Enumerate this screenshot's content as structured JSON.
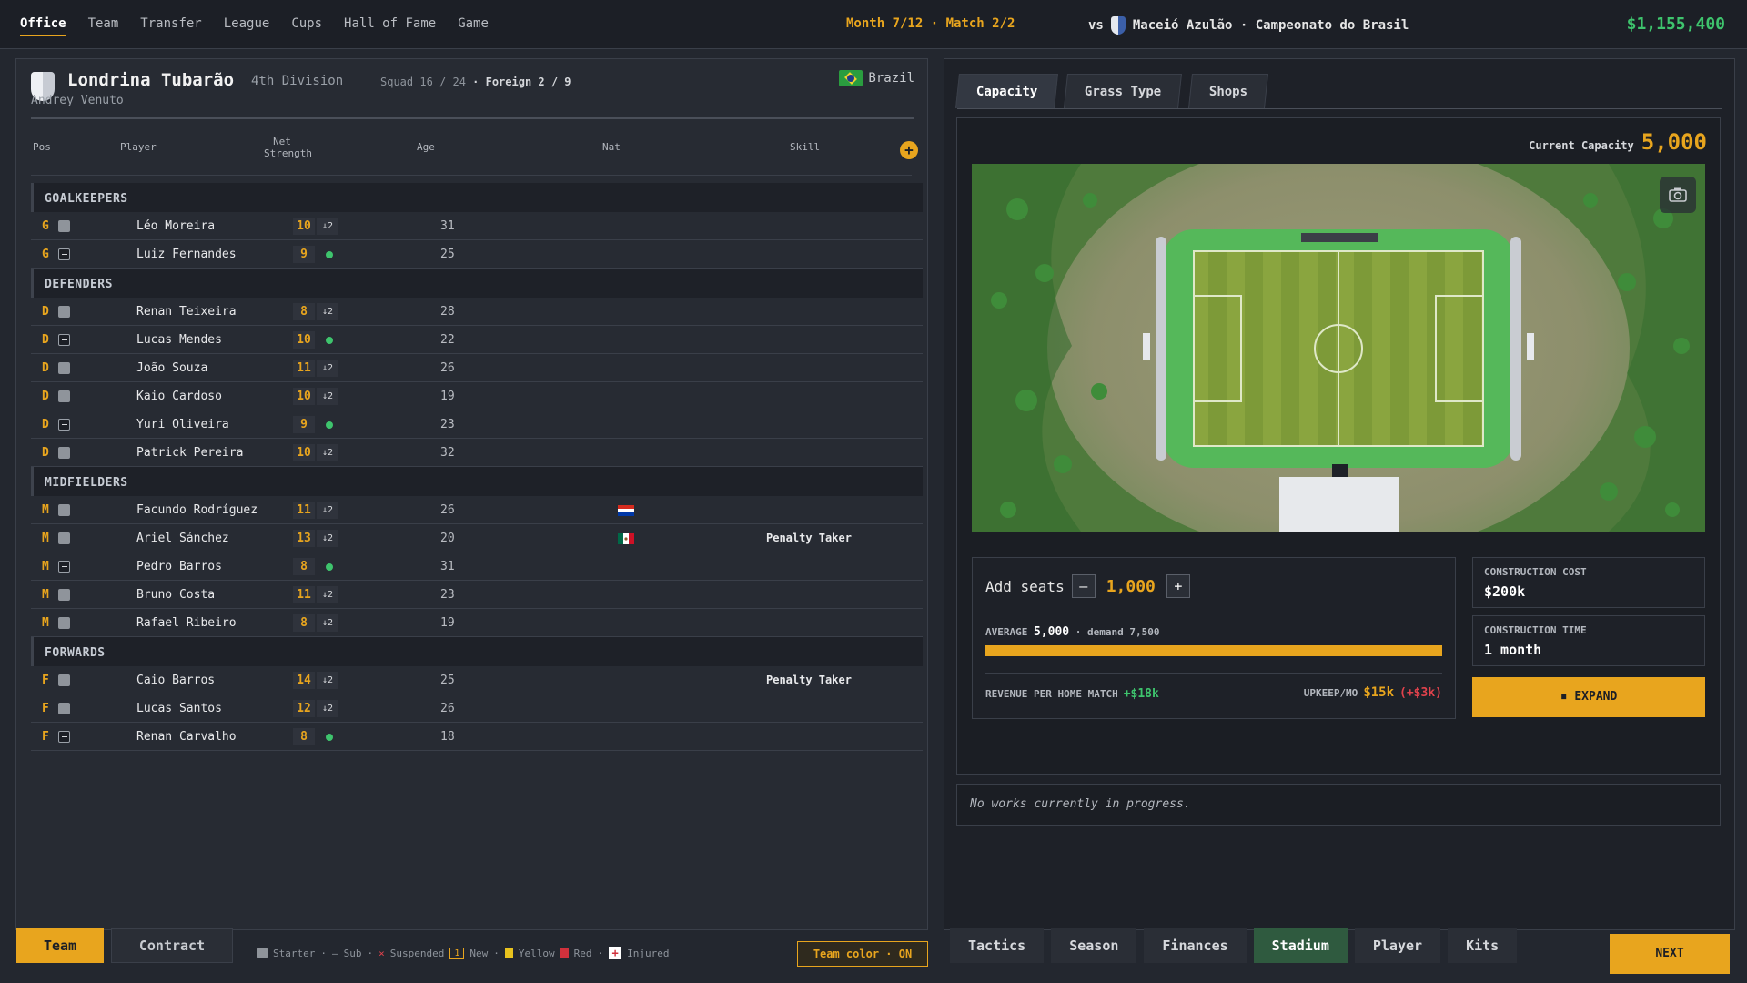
{
  "nav": {
    "items": [
      "Office",
      "Team",
      "Transfer",
      "League",
      "Cups",
      "Hall of Fame",
      "Game"
    ],
    "active": "Office"
  },
  "match_info": "Month 7/12 · Match 2/2",
  "opponent": {
    "vs": "vs",
    "name": "Maceió Azulão · Campeonato do Brasil"
  },
  "money": "$1,155,400",
  "club": {
    "name": "Londrina Tubarão",
    "division": "4th Division",
    "squad_label": "Squad 16 / 24",
    "foreign_label": "· Foreign 2 / 9",
    "country": "Brazil",
    "manager": "Andrey Venuto"
  },
  "columns": {
    "pos": "Pos",
    "player": "Player",
    "net1": "Net",
    "net2": "Strength",
    "age": "Age",
    "nat": "Nat",
    "skill": "Skill"
  },
  "sections": [
    {
      "title": "GOALKEEPERS",
      "players": [
        {
          "pos": "G",
          "status": "starter",
          "name": "Léo Moreira",
          "ns": "10",
          "trend": "↓2",
          "age": "31",
          "nat": "",
          "skill": ""
        },
        {
          "pos": "G",
          "status": "sub",
          "name": "Luiz Fernandes",
          "ns": "9",
          "trend": "dot",
          "age": "25",
          "nat": "",
          "skill": ""
        }
      ]
    },
    {
      "title": "DEFENDERS",
      "players": [
        {
          "pos": "D",
          "status": "starter",
          "name": "Renan Teixeira",
          "ns": "8",
          "trend": "↓2",
          "age": "28",
          "nat": "",
          "skill": ""
        },
        {
          "pos": "D",
          "status": "sub",
          "name": "Lucas Mendes",
          "ns": "10",
          "trend": "dot",
          "age": "22",
          "nat": "",
          "skill": ""
        },
        {
          "pos": "D",
          "status": "starter",
          "name": "João Souza",
          "ns": "11",
          "trend": "↓2",
          "age": "26",
          "nat": "",
          "skill": ""
        },
        {
          "pos": "D",
          "status": "starter",
          "name": "Kaio Cardoso",
          "ns": "10",
          "trend": "↓2",
          "age": "19",
          "nat": "",
          "skill": ""
        },
        {
          "pos": "D",
          "status": "sub",
          "name": "Yuri Oliveira",
          "ns": "9",
          "trend": "dot",
          "age": "23",
          "nat": "",
          "skill": ""
        },
        {
          "pos": "D",
          "status": "starter",
          "name": "Patrick Pereira",
          "ns": "10",
          "trend": "↓2",
          "age": "32",
          "nat": "",
          "skill": ""
        }
      ]
    },
    {
      "title": "MIDFIELDERS",
      "players": [
        {
          "pos": "M",
          "status": "starter",
          "name": "Facundo Rodríguez",
          "ns": "11",
          "trend": "↓2",
          "age": "26",
          "nat": "paraguay",
          "skill": ""
        },
        {
          "pos": "M",
          "status": "starter",
          "name": "Ariel Sánchez",
          "ns": "13",
          "trend": "↓2",
          "age": "20",
          "nat": "mexico",
          "skill": "Penalty Taker"
        },
        {
          "pos": "M",
          "status": "sub",
          "name": "Pedro Barros",
          "ns": "8",
          "trend": "dot",
          "age": "31",
          "nat": "",
          "skill": ""
        },
        {
          "pos": "M",
          "status": "starter",
          "name": "Bruno Costa",
          "ns": "11",
          "trend": "↓2",
          "age": "23",
          "nat": "",
          "skill": ""
        },
        {
          "pos": "M",
          "status": "starter",
          "name": "Rafael Ribeiro",
          "ns": "8",
          "trend": "↓2",
          "age": "19",
          "nat": "",
          "skill": ""
        }
      ]
    },
    {
      "title": "FORWARDS",
      "players": [
        {
          "pos": "F",
          "status": "starter",
          "name": "Caio Barros",
          "ns": "14",
          "trend": "↓2",
          "age": "25",
          "nat": "",
          "skill": "Penalty Taker"
        },
        {
          "pos": "F",
          "status": "starter",
          "name": "Lucas Santos",
          "ns": "12",
          "trend": "↓2",
          "age": "26",
          "nat": "",
          "skill": ""
        },
        {
          "pos": "F",
          "status": "sub",
          "name": "Renan Carvalho",
          "ns": "8",
          "trend": "dot",
          "age": "18",
          "nat": "",
          "skill": ""
        }
      ]
    }
  ],
  "left_tabs": {
    "team": "Team",
    "contract": "Contract"
  },
  "legend": {
    "starter": "Starter",
    "sub": "Sub",
    "suspended": "Suspended",
    "new_box": "1",
    "new": "New",
    "yellow": "Yellow",
    "red": "Red",
    "injured": "Injured",
    "sep": "·",
    "sub_mark": "–",
    "susp_mark": "×",
    "inj_mark": "+"
  },
  "team_color": "Team color · ON",
  "stadium_tabs": [
    "Capacity",
    "Grass Type",
    "Shops"
  ],
  "capacity": {
    "label": "Current Capacity",
    "value": "5,000"
  },
  "seats": {
    "label": "Add seats",
    "minus": "–",
    "plus": "+",
    "value": "1,000"
  },
  "attendance": {
    "avg_label": "AVERAGE",
    "avg_value": "5,000",
    "demand": "· demand 7,500",
    "fill_fraction": 1.0
  },
  "revenue": {
    "label": "REVENUE PER HOME MATCH",
    "value": "+$18k"
  },
  "upkeep": {
    "label": "UPKEEP/MO",
    "value": "$15k",
    "delta": "(+$3k)"
  },
  "construction": {
    "cost_label": "CONSTRUCTION COST",
    "cost": "$200k",
    "time_label": "CONSTRUCTION TIME",
    "time": "1 month"
  },
  "expand_label": "EXPAND",
  "works_text": "No works currently in progress.",
  "bottom_tabs": [
    "Tactics",
    "Season",
    "Finances",
    "Stadium",
    "Player",
    "Kits"
  ],
  "bottom_active": "Stadium",
  "next_label": "NEXT",
  "colors": {
    "accent": "#e8a51e",
    "money": "#3ec46d",
    "bg": "#23272f"
  }
}
